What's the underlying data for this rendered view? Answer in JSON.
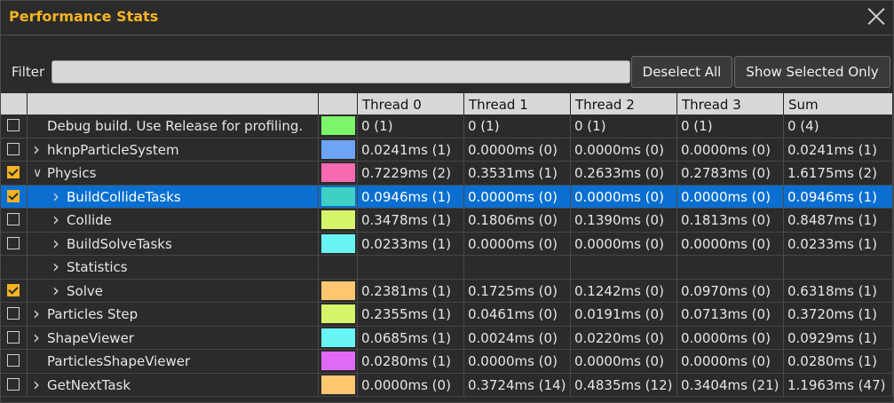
{
  "window": {
    "title": "Performance Stats"
  },
  "filter": {
    "label": "Filter",
    "value": "",
    "placeholder": ""
  },
  "buttons": {
    "deselect_all": "Deselect All",
    "show_selected_only": "Show Selected Only"
  },
  "columns": [
    "Thread 0",
    "Thread 1",
    "Thread 2",
    "Thread 3",
    "Sum"
  ],
  "rows": [
    {
      "checked": false,
      "has_checkbox": true,
      "expander": "",
      "indent": 0,
      "name": "Debug build. Use Release for profiling.",
      "color": "#7cf56a",
      "values": [
        "0 (1)",
        "0 (1)",
        "0 (1)",
        "0 (1)",
        "0 (4)"
      ]
    },
    {
      "checked": false,
      "has_checkbox": true,
      "expander": ">",
      "indent": 0,
      "name": "hknpParticleSystem",
      "color": "#6ea4f5",
      "values": [
        "0.0241ms (1)",
        "0.0000ms (0)",
        "0.0000ms (0)",
        "0.0000ms (0)",
        "0.0241ms (1)"
      ]
    },
    {
      "checked": true,
      "has_checkbox": true,
      "expander": "v",
      "indent": 0,
      "name": "Physics",
      "color": "#f56ab1",
      "values": [
        "0.7229ms (2)",
        "0.3531ms (1)",
        "0.2633ms (0)",
        "0.2783ms (0)",
        "1.6175ms (2)"
      ]
    },
    {
      "checked": true,
      "has_checkbox": true,
      "expander": ">",
      "indent": 1,
      "name": "BuildCollideTasks",
      "color": "#3fcfc4",
      "selected": true,
      "values": [
        "0.0946ms (1)",
        "0.0000ms (0)",
        "0.0000ms (0)",
        "0.0000ms (0)",
        "0.0946ms (1)"
      ]
    },
    {
      "checked": false,
      "has_checkbox": true,
      "expander": ">",
      "indent": 1,
      "name": "Collide",
      "color": "#d6f56a",
      "values": [
        "0.3478ms (1)",
        "0.1806ms (0)",
        "0.1390ms (0)",
        "0.1813ms (0)",
        "0.8487ms (1)"
      ]
    },
    {
      "checked": false,
      "has_checkbox": true,
      "expander": ">",
      "indent": 1,
      "name": "BuildSolveTasks",
      "color": "#6af5f5",
      "values": [
        "0.0233ms (1)",
        "0.0000ms (0)",
        "0.0000ms (0)",
        "0.0000ms (0)",
        "0.0233ms (1)"
      ]
    },
    {
      "checked": false,
      "has_checkbox": false,
      "expander": ">",
      "indent": 1,
      "name": "Statistics",
      "color": "",
      "values": [
        "",
        "",
        "",
        "",
        ""
      ]
    },
    {
      "checked": true,
      "has_checkbox": true,
      "expander": ">",
      "indent": 1,
      "name": "Solve",
      "color": "#ffc870",
      "values": [
        "0.2381ms (1)",
        "0.1725ms (0)",
        "0.1242ms (0)",
        "0.0970ms (0)",
        "0.6318ms (1)"
      ]
    },
    {
      "checked": false,
      "has_checkbox": true,
      "expander": ">",
      "indent": 0,
      "name": "Particles Step",
      "color": "#d6f56a",
      "values": [
        "0.2355ms (1)",
        "0.0461ms (0)",
        "0.0191ms (0)",
        "0.0713ms (0)",
        "0.3720ms (1)"
      ]
    },
    {
      "checked": false,
      "has_checkbox": true,
      "expander": ">",
      "indent": 0,
      "name": "ShapeViewer",
      "color": "#6af5f5",
      "values": [
        "0.0685ms (1)",
        "0.0024ms (0)",
        "0.0220ms (0)",
        "0.0000ms (0)",
        "0.0929ms (1)"
      ]
    },
    {
      "checked": false,
      "has_checkbox": true,
      "expander": "",
      "indent": 0,
      "name": "ParticlesShapeViewer",
      "color": "#e06af5",
      "values": [
        "0.0280ms (1)",
        "0.0000ms (0)",
        "0.0000ms (0)",
        "0.0000ms (0)",
        "0.0280ms (1)"
      ]
    },
    {
      "checked": false,
      "has_checkbox": true,
      "expander": ">",
      "indent": 0,
      "name": "GetNextTask",
      "color": "#ffc870",
      "values": [
        "0.0000ms (0)",
        "0.3724ms (14)",
        "0.4835ms (12)",
        "0.3404ms (21)",
        "1.1963ms (47)"
      ]
    }
  ]
}
